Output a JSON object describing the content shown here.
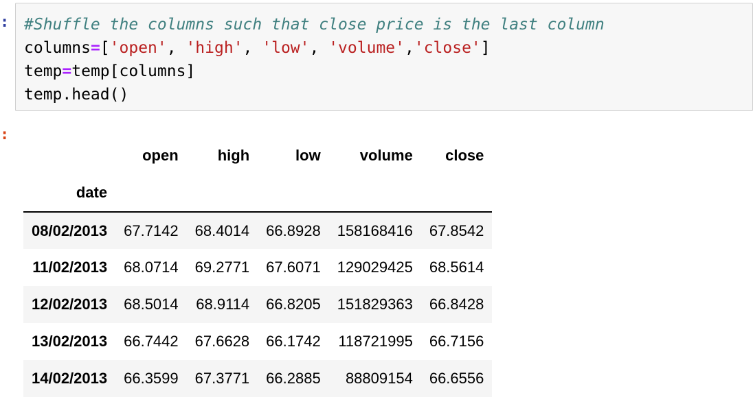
{
  "prompts": {
    "in": ":",
    "out": ":"
  },
  "code_cell": {
    "line1": {
      "comment": "#Shuffle the columns such that close price is the last column"
    },
    "line2": {
      "a": "columns",
      "op": "=",
      "b": "[",
      "s1": "'open'",
      "c1": ", ",
      "s2": "'high'",
      "c2": ", ",
      "s3": "'low'",
      "c3": ", ",
      "s4": "'volume'",
      "c4": ",",
      "s5": "'close'",
      "end": "]"
    },
    "line3": {
      "a": "temp",
      "op": "=",
      "b": "temp[columns]"
    },
    "line4": {
      "a": "temp.head()"
    }
  },
  "dataframe": {
    "columns": [
      "open",
      "high",
      "low",
      "volume",
      "close"
    ],
    "index_name": "date",
    "rows": [
      {
        "date": "08/02/2013",
        "open": "67.7142",
        "high": "68.4014",
        "low": "66.8928",
        "volume": "158168416",
        "close": "67.8542"
      },
      {
        "date": "11/02/2013",
        "open": "68.0714",
        "high": "69.2771",
        "low": "67.6071",
        "volume": "129029425",
        "close": "68.5614"
      },
      {
        "date": "12/02/2013",
        "open": "68.5014",
        "high": "68.9114",
        "low": "66.8205",
        "volume": "151829363",
        "close": "66.8428"
      },
      {
        "date": "13/02/2013",
        "open": "66.7442",
        "high": "67.6628",
        "low": "66.1742",
        "volume": "118721995",
        "close": "66.7156"
      },
      {
        "date": "14/02/2013",
        "open": "66.3599",
        "high": "67.3771",
        "low": "66.2885",
        "volume": "88809154",
        "close": "66.6556"
      }
    ]
  }
}
